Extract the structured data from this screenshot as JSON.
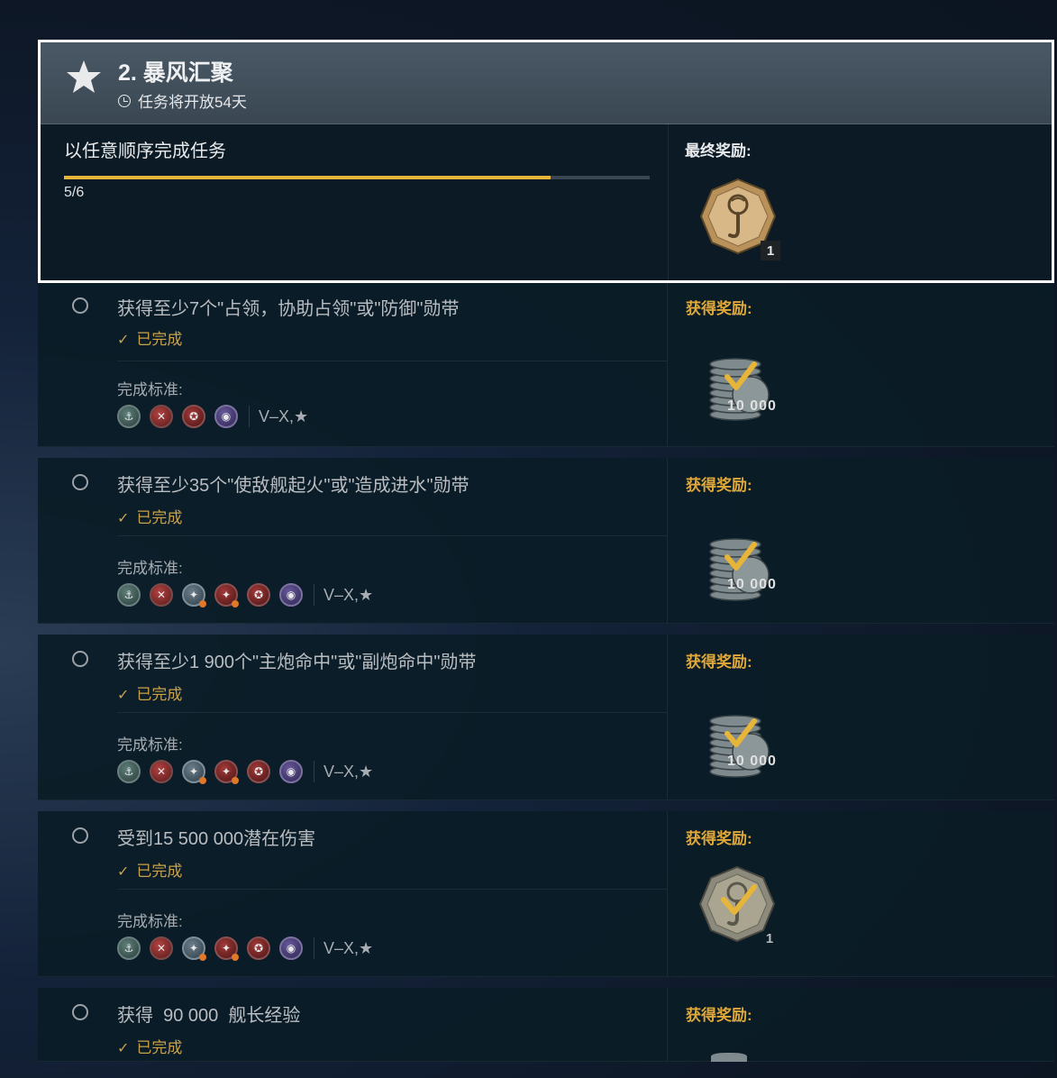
{
  "header": {
    "title": "2. 暴风汇聚",
    "subtitle": "任务将开放54天",
    "order_text": "以任意顺序完成任务",
    "progress_text": "5/6",
    "progress_fraction": 0.83,
    "final_reward_label": "最终奖励:",
    "final_reward_count": "1"
  },
  "tasks": [
    {
      "title": "获得至少7个\"占领，协助占领\"或\"防御\"勋带",
      "done": "已完成",
      "criteria_label": "完成标准:",
      "tiers": "V–X,★",
      "reward_label": "获得奖励:",
      "reward_amount": "10 000"
    },
    {
      "title": "获得至少35个\"使敌舰起火\"或\"造成进水\"勋带",
      "done": "已完成",
      "criteria_label": "完成标准:",
      "tiers": "V–X,★",
      "reward_label": "获得奖励:",
      "reward_amount": "10 000"
    },
    {
      "title": "获得至少1 900个\"主炮命中\"或\"副炮命中\"勋带",
      "done": "已完成",
      "criteria_label": "完成标准:",
      "tiers": "V–X,★",
      "reward_label": "获得奖励:",
      "reward_amount": "10 000"
    },
    {
      "title": "受到15 500 000潜在伤害",
      "done": "已完成",
      "criteria_label": "完成标准:",
      "tiers": "V–X,★",
      "reward_label": "获得奖励:",
      "reward_amount": "1"
    },
    {
      "title": "获得  90 000  舰长经验",
      "done": "已完成",
      "reward_label": "获得奖励:"
    }
  ],
  "colors": {
    "accent": "#e6b53a",
    "done": "#c9a24a"
  }
}
